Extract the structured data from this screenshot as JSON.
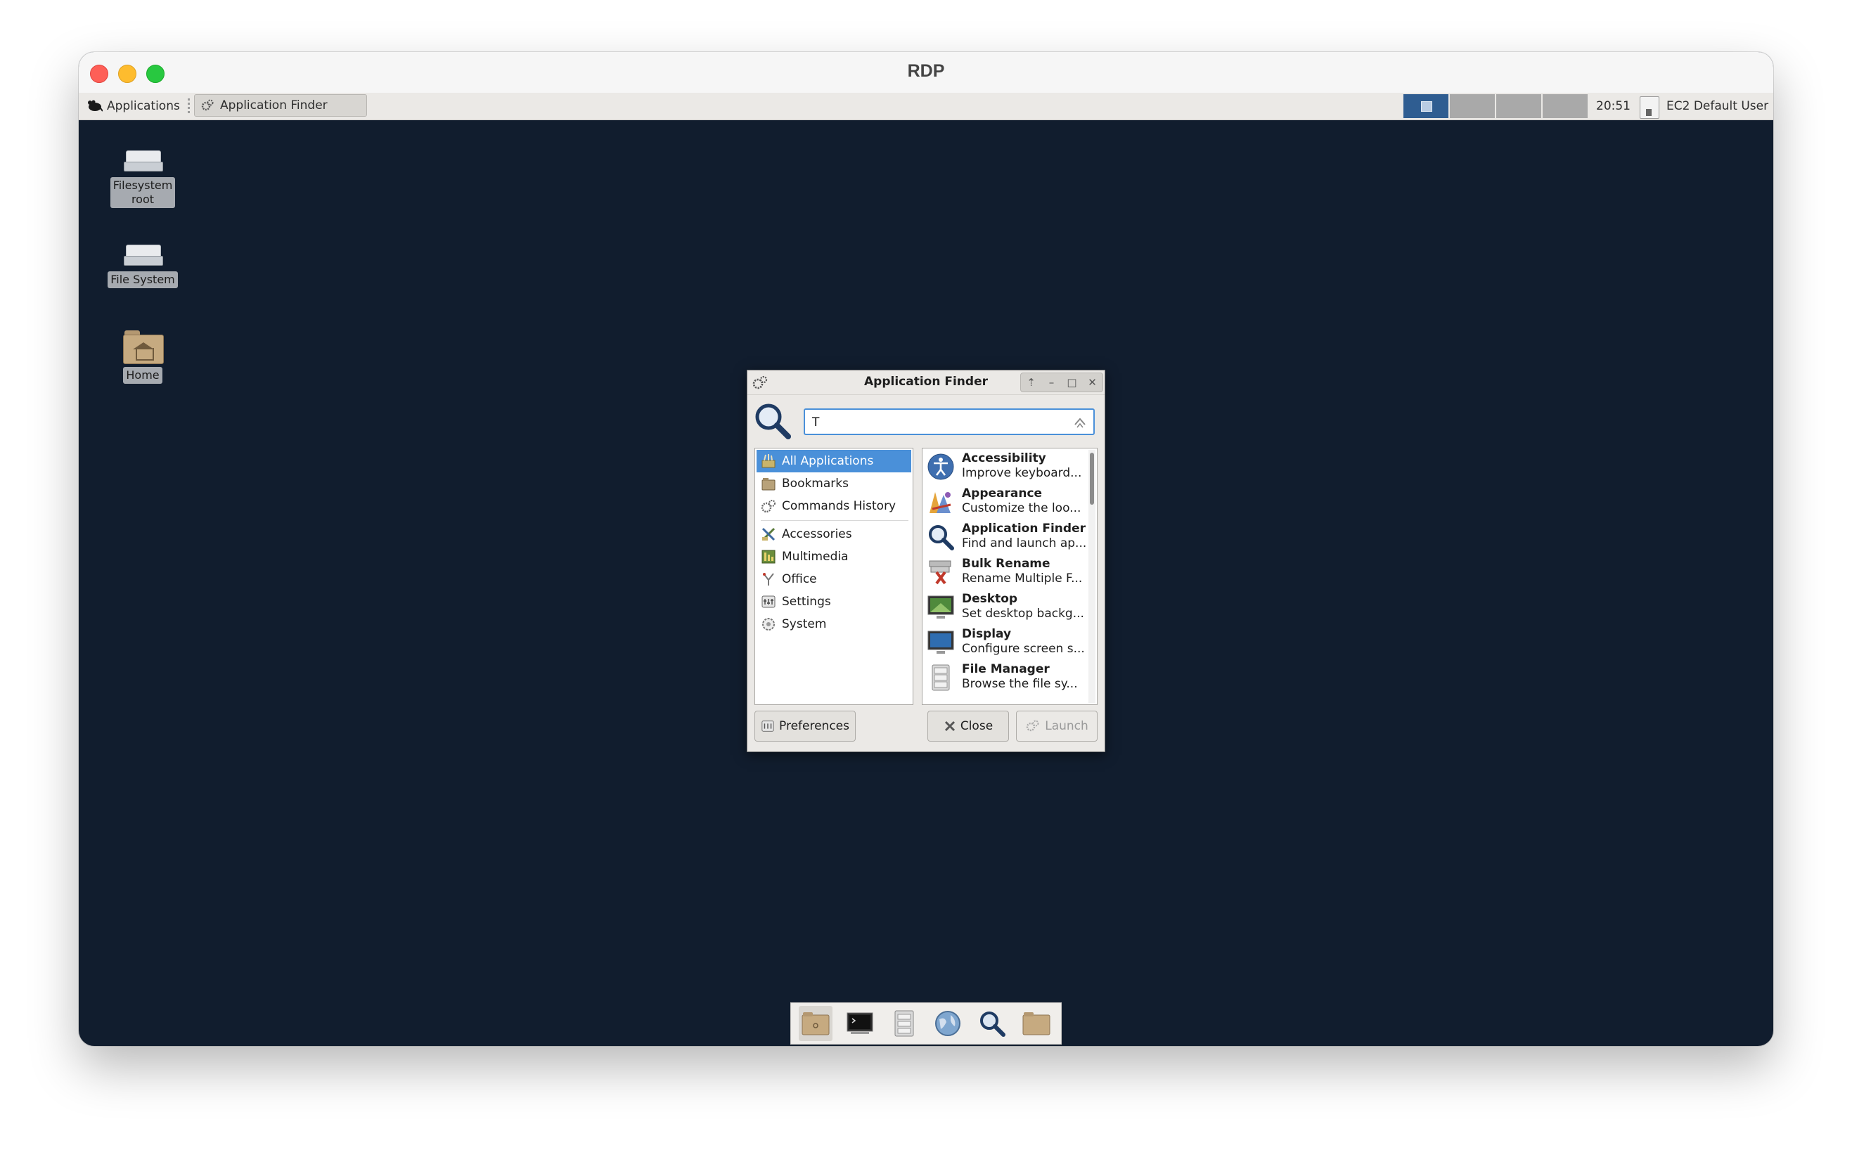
{
  "window": {
    "title": "RDP"
  },
  "panel": {
    "applications_label": "Applications",
    "task_label": "Application Finder",
    "clock": "20:51",
    "user": "EC2 Default User",
    "workspaces": 4,
    "active_workspace": 1
  },
  "desktop": {
    "icons": [
      {
        "label_line1": "Filesystem",
        "label_line2": "root"
      },
      {
        "label_line1": "File System",
        "label_line2": ""
      },
      {
        "label_line1": "Home",
        "label_line2": ""
      }
    ],
    "background": "#111d2e"
  },
  "finder": {
    "title": "Application Finder",
    "search_value": "T",
    "categories": [
      {
        "label": "All Applications",
        "icon": "all-apps-icon",
        "selected": true
      },
      {
        "label": "Bookmarks",
        "icon": "bookmarks-icon"
      },
      {
        "label": "Commands History",
        "icon": "history-icon"
      },
      {
        "label": "Accessories",
        "icon": "accessories-icon"
      },
      {
        "label": "Multimedia",
        "icon": "multimedia-icon"
      },
      {
        "label": "Office",
        "icon": "office-icon"
      },
      {
        "label": "Settings",
        "icon": "settings-icon"
      },
      {
        "label": "System",
        "icon": "system-icon"
      }
    ],
    "apps": [
      {
        "name": "Accessibility",
        "desc": "Improve keyboard...",
        "icon": "accessibility-icon"
      },
      {
        "name": "Appearance",
        "desc": "Customize the loo...",
        "icon": "appearance-icon"
      },
      {
        "name": "Application Finder",
        "desc": "Find and launch ap...",
        "icon": "app-finder-icon"
      },
      {
        "name": "Bulk Rename",
        "desc": "Rename Multiple F...",
        "icon": "bulk-rename-icon"
      },
      {
        "name": "Desktop",
        "desc": "Set desktop backg...",
        "icon": "desktop-icon"
      },
      {
        "name": "Display",
        "desc": "Configure screen s...",
        "icon": "display-icon"
      },
      {
        "name": "File Manager",
        "desc": "Browse the file sy...",
        "icon": "file-manager-icon"
      }
    ],
    "buttons": {
      "preferences": "Preferences",
      "close": "Close",
      "launch": "Launch"
    },
    "accent": "#4a90d9"
  },
  "dock": {
    "items": [
      "home-folder-icon",
      "terminal-icon",
      "file-manager-icon",
      "web-browser-icon",
      "search-icon",
      "folder-icon"
    ]
  }
}
